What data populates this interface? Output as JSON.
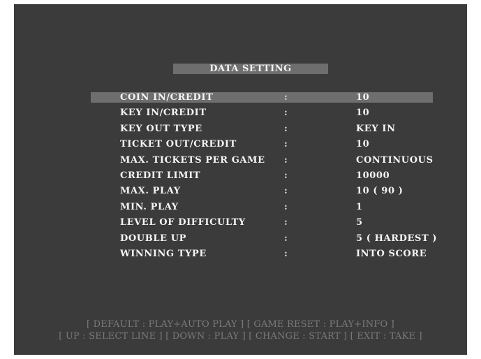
{
  "screen": {
    "title": "DATA SETTING",
    "settings": [
      {
        "label": "COIN IN/CREDIT",
        "sep": ":",
        "value": "10"
      },
      {
        "label": "KEY IN/CREDIT",
        "sep": ":",
        "value": "10"
      },
      {
        "label": "KEY OUT TYPE",
        "sep": ":",
        "value": "KEY IN"
      },
      {
        "label": "TICKET OUT/CREDIT",
        "sep": ":",
        "value": "10"
      },
      {
        "label": "MAX. TICKETS PER GAME",
        "sep": ":",
        "value": "CONTINUOUS"
      },
      {
        "label": "CREDIT LIMIT",
        "sep": ":",
        "value": "10000"
      },
      {
        "label": "MAX. PLAY",
        "sep": ":",
        "value": "10 ( 90 )"
      },
      {
        "label": "MIN. PLAY",
        "sep": ":",
        "value": "1"
      },
      {
        "label": "LEVEL OF DIFFICULTY",
        "sep": ":",
        "value": "5"
      },
      {
        "label": "DOUBLE UP",
        "sep": ":",
        "value": "5 ( HARDEST )"
      },
      {
        "label": "WINNING TYPE",
        "sep": ":",
        "value": "INTO SCORE"
      }
    ],
    "help_line_1": "[ DEFAULT : PLAY+AUTO PLAY ]   [ GAME RESET : PLAY+INFO ]",
    "help_line_2": "[ UP : SELECT LINE ] [ DOWN : PLAY ] [ CHANGE : START ] [ EXIT : TAKE ]",
    "colors": {
      "background": "#3b3b3b",
      "highlight": "#6e6e6e",
      "text": "#f5f5f5",
      "help_text": "#7a7a7a"
    }
  }
}
